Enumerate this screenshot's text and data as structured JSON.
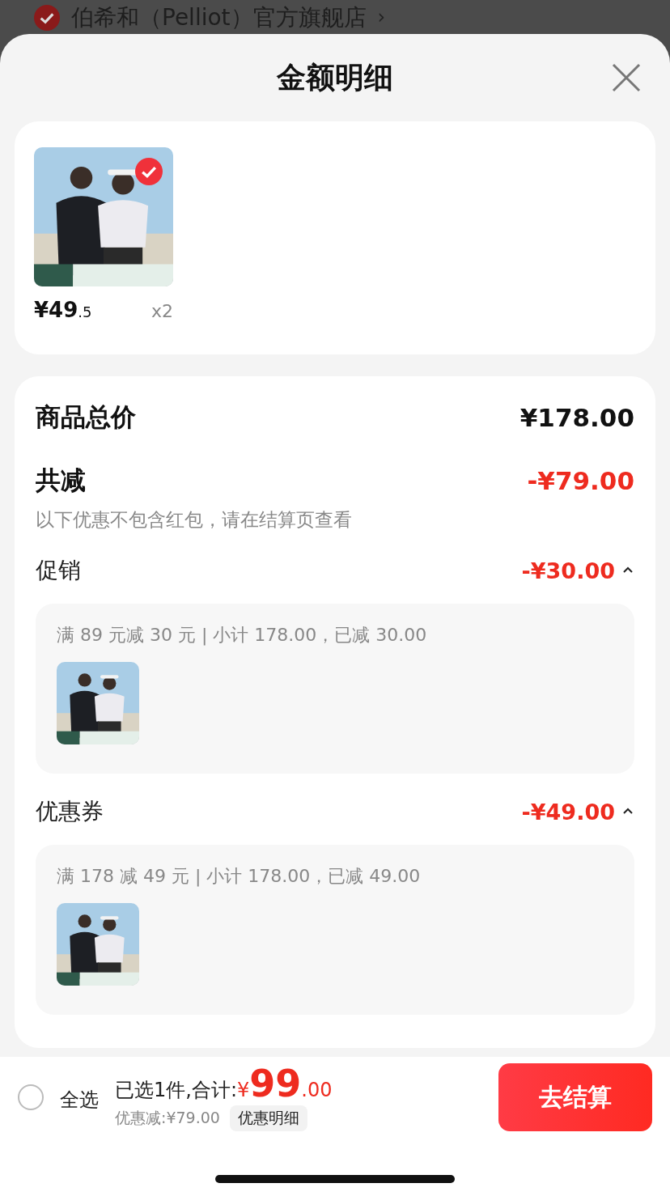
{
  "store": {
    "name": "伯希和（Pelliot）官方旗舰店",
    "checked": true,
    "chevron": "›"
  },
  "sheet": {
    "title": "金额明细"
  },
  "items": [
    {
      "kind": "picture",
      "selected": true,
      "price_main": "¥49",
      "price_decimal": ".5",
      "quantity": "x2"
    }
  ],
  "summary": {
    "total_label": "商品总价",
    "total_value": "¥178.00",
    "discount_label": "共减",
    "discount_value": "-¥79.00",
    "note": "以下优惠不包含红包，请在结算页查看"
  },
  "discounts": [
    {
      "label": "促销",
      "value": "-¥30.00",
      "expanded": true,
      "detail": "满 89 元减 30 元 | 小计 178.00，已减 30.00"
    },
    {
      "label": "优惠券",
      "value": "-¥49.00",
      "expanded": true,
      "detail": "满 178 减 49 元 | 小计 178.00，已减 49.00"
    }
  ],
  "bottom_bar": {
    "select_all": {
      "label": "全选",
      "checked": false
    },
    "selected_text": "已选1件,合计:",
    "currency": "¥",
    "amount": "99",
    "decimal": ".00",
    "savings": "优惠减:¥79.00",
    "details_button": "优惠明细",
    "checkout": "去结算"
  }
}
